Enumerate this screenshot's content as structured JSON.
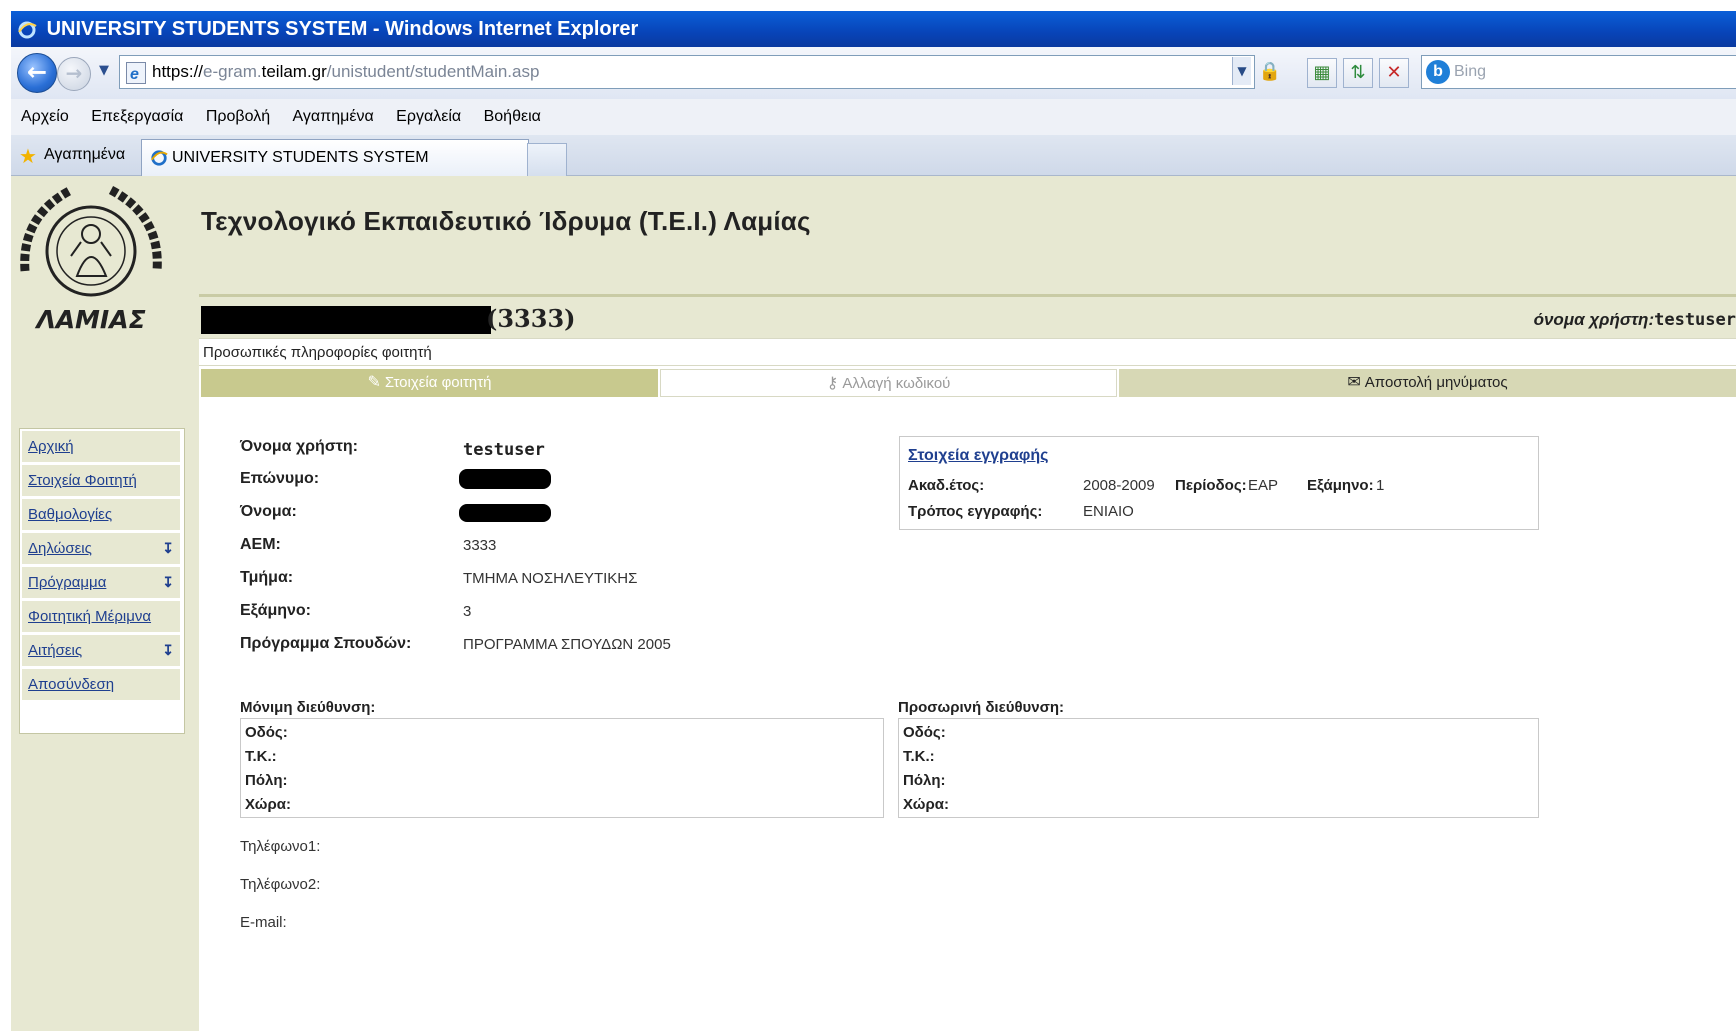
{
  "window": {
    "title": "UNIVERSITY STUDENTS SYSTEM - Windows Internet Explorer"
  },
  "address_bar": {
    "protocol": "https://",
    "pre_host": "e-gram.",
    "host": "teilam.gr",
    "path": "/unistudent/studentMain.asp"
  },
  "search": {
    "placeholder": "Bing"
  },
  "menu": [
    "Αρχείο",
    "Επεξεργασία",
    "Προβολή",
    "Αγαπημένα",
    "Εργαλεία",
    "Βοήθεια"
  ],
  "favorites_label": "Αγαπημένα",
  "browser_tab": {
    "label": "UNIVERSITY STUDENTS SYSTEM"
  },
  "header": {
    "institution": "Τεχνολογικό Εκπαιδευτικό Ίδρυμα (Τ.Ε.Ι.) Λαμίας",
    "student_id_suffix": "(3333)",
    "username_label": "όνομα χρήστη:",
    "username": "testuser"
  },
  "logo": {
    "text": "ΛΑΜΙΑΣ"
  },
  "section_label": "Προσωπικές πληροφορίες φοιτητή",
  "page_tabs": [
    {
      "label": "Στοιχεία φοιτητή",
      "icon": "edit-icon"
    },
    {
      "label": "Αλλαγή κωδικού",
      "icon": "key-icon"
    },
    {
      "label": "Αποστολή μηνύματος",
      "icon": "envelope-icon"
    }
  ],
  "sidebar": {
    "items": [
      {
        "label": "Αρχική",
        "dropdown": false
      },
      {
        "label": "Στοιχεία Φοιτητή",
        "dropdown": false
      },
      {
        "label": "Βαθμολογίες",
        "dropdown": false
      },
      {
        "label": "Δηλώσεις",
        "dropdown": true
      },
      {
        "label": "Πρόγραμμα",
        "dropdown": true
      },
      {
        "label": "Φοιτητική Μέριμνα",
        "dropdown": false
      },
      {
        "label": "Αιτήσεις",
        "dropdown": true
      },
      {
        "label": "Αποσύνδεση",
        "dropdown": false
      }
    ]
  },
  "student": {
    "username_label": "Όνομα χρήστη:",
    "username": "testuser",
    "surname_label": "Επώνυμο:",
    "firstname_label": "Όνομα:",
    "aem_label": "ΑΕΜ:",
    "aem": "3333",
    "department_label": "Τμήμα:",
    "department": "ΤΜΗΜΑ ΝΟΣΗΛΕΥΤΙΚΗΣ",
    "semester_label": "Εξάμηνο:",
    "semester": "3",
    "program_label": "Πρόγραμμα Σπουδών:",
    "program": "ΠΡΟΓΡΑΜΜΑ ΣΠΟΥΔΩΝ 2005"
  },
  "registration": {
    "title": "Στοιχεία εγγραφής",
    "acad_year_label": "Ακαδ.έτος:",
    "acad_year": "2008-2009",
    "period_label": "Περίοδος:",
    "period": "ΕΑΡ",
    "semester_label": "Εξάμηνο:",
    "semester": "1",
    "mode_label": "Τρόπος εγγραφής:",
    "mode": "ΕΝΙΑΙΟ"
  },
  "permanent_address": {
    "title": "Μόνιμη διεύθυνση:",
    "street_label": "Οδός:",
    "zip_label": "Τ.Κ.:",
    "city_label": "Πόλη:",
    "country_label": "Χώρα:"
  },
  "temporary_address": {
    "title": "Προσωρινή διεύθυνση:",
    "street_label": "Οδός:",
    "zip_label": "Τ.Κ.:",
    "city_label": "Πόλη:",
    "country_label": "Χώρα:"
  },
  "contact": {
    "phone1_label": "Τηλέφωνο1:",
    "phone2_label": "Τηλέφωνο2:",
    "email_label": "E-mail:"
  }
}
